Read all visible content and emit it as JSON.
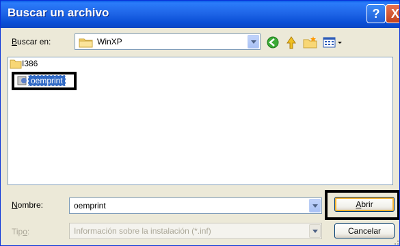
{
  "window": {
    "title": "Buscar un archivo",
    "help_glyph": "?",
    "close_glyph": "X"
  },
  "lookin": {
    "label_prefix": "",
    "label_hotkey": "B",
    "label_rest": "uscar en:",
    "value": "WinXP"
  },
  "files": [
    {
      "name": "I386",
      "type": "folder-icon"
    },
    {
      "name": "oemprint",
      "type": "setup-information-icon",
      "selected": true
    }
  ],
  "filename": {
    "label_hotkey": "N",
    "label_rest": "ombre:",
    "value": "oemprint"
  },
  "filetype": {
    "label_prefix": "Tip",
    "label_hotkey": "o",
    "label_rest": ":",
    "value": "Información sobre la instalación (*.inf)"
  },
  "buttons": {
    "open_hotkey": "A",
    "open_rest": "brir",
    "cancel": "Cancelar"
  },
  "colors": {
    "titlebar": "#0A4FD6",
    "selection": "#316AC5",
    "highlight_box": "#000000"
  }
}
